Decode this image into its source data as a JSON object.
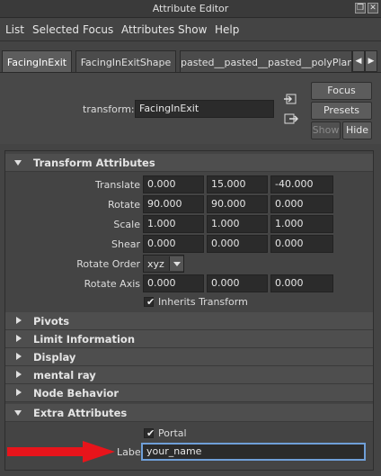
{
  "window": {
    "title": "Attribute Editor"
  },
  "menu": [
    "List",
    "Selected",
    "Focus",
    "Attributes",
    "Show",
    "Help"
  ],
  "tabs": [
    "FacingInExit",
    "FacingInExitShape",
    "pasted__pasted__pasted__polyPlane"
  ],
  "header": {
    "transform_label": "transform:",
    "transform_value": "FacingInExit",
    "focus_label": "Focus",
    "presets_label": "Presets",
    "show_label": "Show",
    "hide_label": "Hide"
  },
  "transform_attributes": {
    "title": "Transform Attributes",
    "translate": {
      "label": "Translate",
      "values": [
        "0.000",
        "15.000",
        "-40.000"
      ]
    },
    "rotate": {
      "label": "Rotate",
      "values": [
        "90.000",
        "90.000",
        "0.000"
      ]
    },
    "scale": {
      "label": "Scale",
      "values": [
        "1.000",
        "1.000",
        "1.000"
      ]
    },
    "shear": {
      "label": "Shear",
      "values": [
        "0.000",
        "0.000",
        "0.000"
      ]
    },
    "rotate_order": {
      "label": "Rotate Order",
      "value": "xyz"
    },
    "rotate_axis": {
      "label": "Rotate Axis",
      "values": [
        "0.000",
        "0.000",
        "0.000"
      ]
    },
    "inherits_transform": {
      "label": "Inherits Transform",
      "checked": true
    }
  },
  "collapsed_sections": [
    "Pivots",
    "Limit Information",
    "Display",
    "mental ray",
    "Node Behavior"
  ],
  "extra_attributes": {
    "title": "Extra Attributes",
    "portal": {
      "label": "Portal",
      "checked": true
    },
    "label_field": {
      "label": "Label",
      "value": "your_name"
    }
  },
  "colors": {
    "arrow": "#e8141b",
    "active_field_border": "#6f9fd8"
  }
}
